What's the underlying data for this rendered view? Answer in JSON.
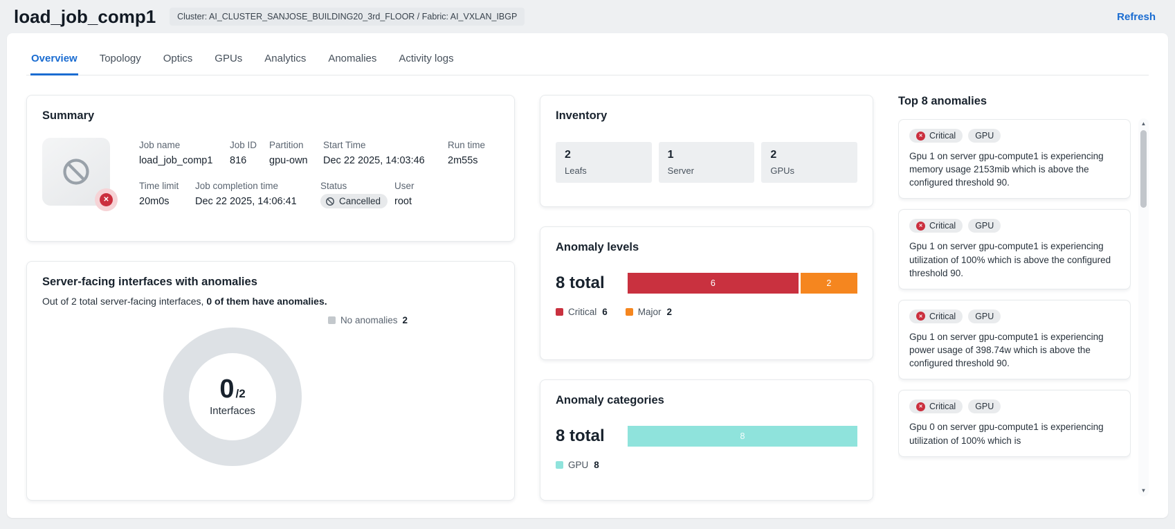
{
  "header": {
    "title": "load_job_comp1",
    "cluster_badge": "Cluster: AI_CLUSTER_SANJOSE_BUILDING20_3rd_FLOOR / Fabric: AI_VXLAN_IBGP",
    "refresh_label": "Refresh"
  },
  "tabs": [
    {
      "label": "Overview"
    },
    {
      "label": "Topology"
    },
    {
      "label": "Optics"
    },
    {
      "label": "GPUs"
    },
    {
      "label": "Analytics"
    },
    {
      "label": "Anomalies"
    },
    {
      "label": "Activity logs"
    }
  ],
  "summary": {
    "title": "Summary",
    "row1": [
      {
        "label": "Job name",
        "value": "load_job_comp1"
      },
      {
        "label": "Job ID",
        "value": "816"
      },
      {
        "label": "Partition",
        "value": "gpu-own"
      },
      {
        "label": "Start Time",
        "value": "Dec 22 2025, 14:03:46"
      },
      {
        "label": "Run time",
        "value": "2m55s"
      }
    ],
    "row2": [
      {
        "label": "Time limit",
        "value": "20m0s"
      },
      {
        "label": "Job completion time",
        "value": "Dec 22 2025, 14:06:41"
      },
      {
        "label": "Status",
        "value": "Cancelled"
      },
      {
        "label": "User",
        "value": "root"
      }
    ]
  },
  "interfaces": {
    "title": "Server-facing interfaces with anomalies",
    "subtitle_prefix": "Out of 2 total server-facing interfaces, ",
    "subtitle_bold": "0 of them have anomalies.",
    "legend_label": "No anomalies",
    "legend_value": "2",
    "donut_center_value": "0",
    "donut_center_total": "/2",
    "donut_center_label": "Interfaces"
  },
  "inventory": {
    "title": "Inventory",
    "stats": [
      {
        "value": "2",
        "label": "Leafs"
      },
      {
        "value": "1",
        "label": "Server"
      },
      {
        "value": "2",
        "label": "GPUs"
      }
    ]
  },
  "anomaly_levels": {
    "title": "Anomaly levels",
    "total": "8 total",
    "segments": [
      {
        "label": "Critical",
        "value": "6"
      },
      {
        "label": "Major",
        "value": "2"
      }
    ]
  },
  "anomaly_categories": {
    "title": "Anomaly categories",
    "total": "8 total",
    "segments": [
      {
        "label": "GPU",
        "value": "8"
      }
    ]
  },
  "top_anomalies": {
    "title": "Top 8 anomalies",
    "items": [
      {
        "severity": "Critical",
        "category": "GPU",
        "message": "Gpu 1 on server gpu-compute1 is experiencing memory usage 2153mib which is above the configured threshold 90."
      },
      {
        "severity": "Critical",
        "category": "GPU",
        "message": "Gpu 1 on server gpu-compute1 is experiencing utilization of 100% which is above the configured threshold 90."
      },
      {
        "severity": "Critical",
        "category": "GPU",
        "message": "Gpu 1 on server gpu-compute1 is experiencing power usage of 398.74w which is above the configured threshold 90."
      },
      {
        "severity": "Critical",
        "category": "GPU",
        "message": "Gpu 0 on server gpu-compute1 is experiencing utilization of 100% which is"
      }
    ]
  },
  "chart_data": [
    {
      "type": "pie",
      "title": "Server-facing interfaces with anomalies",
      "categories": [
        "No anomalies"
      ],
      "values": [
        2
      ],
      "total": 2,
      "center_label": "0/2 Interfaces",
      "colors": [
        "#dde1e5"
      ]
    },
    {
      "type": "bar",
      "title": "Anomaly levels",
      "categories": [
        "Critical",
        "Major"
      ],
      "values": [
        6,
        2
      ],
      "total": 8,
      "colors": [
        "#c9313f",
        "#f5861f"
      ]
    },
    {
      "type": "bar",
      "title": "Anomaly categories",
      "categories": [
        "GPU"
      ],
      "values": [
        8
      ],
      "total": 8,
      "colors": [
        "#8fe3dc"
      ]
    }
  ],
  "colors": {
    "accent_blue": "#1a6cd1",
    "critical_red": "#c9313f",
    "major_orange": "#f5861f",
    "gpu_teal": "#8fe3dc"
  }
}
